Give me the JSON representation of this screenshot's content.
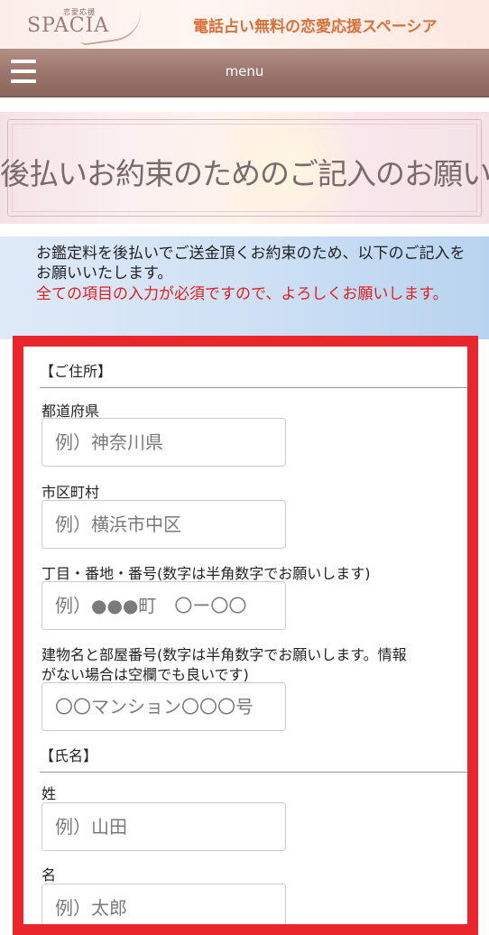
{
  "header": {
    "logo_small": "恋愛応援",
    "logo_main": "SPACIA",
    "site_title": "電話占い無料の恋愛応援スペーシア"
  },
  "nav": {
    "menu_label": "menu"
  },
  "banner": {
    "heading": "後払いお約束のためのご記入のお願い"
  },
  "notice": {
    "text": "お鑑定料を後払いでご送金頂くお約束のため、以下のご記入をお願いいたします。",
    "required_text": "全ての項目の入力が必須ですので、よろしくお願いします。",
    "required_color": "#e02020"
  },
  "form": {
    "border_color": "#e8262b",
    "address_section": "【ご住所】",
    "name_section": "【氏名】",
    "fields": {
      "prefecture": {
        "label": "都道府県",
        "placeholder": "例）神奈川県"
      },
      "city": {
        "label": "市区町村",
        "placeholder": "例）横浜市中区"
      },
      "street": {
        "label": "丁目・番地・番号(数字は半角数字でお願いします)",
        "placeholder": "例）●●●町　〇ー〇〇"
      },
      "building_label_1": "建物名と部屋番号(数字は半角数字でお願いします。情報",
      "building_label_2": "がない場合は空欄でも良いです)",
      "building": {
        "placeholder": "〇〇マンション〇〇〇号"
      },
      "last_name": {
        "label": "姓",
        "placeholder": "例）山田"
      },
      "first_name": {
        "label": "名",
        "placeholder": "例）太郎"
      }
    }
  }
}
